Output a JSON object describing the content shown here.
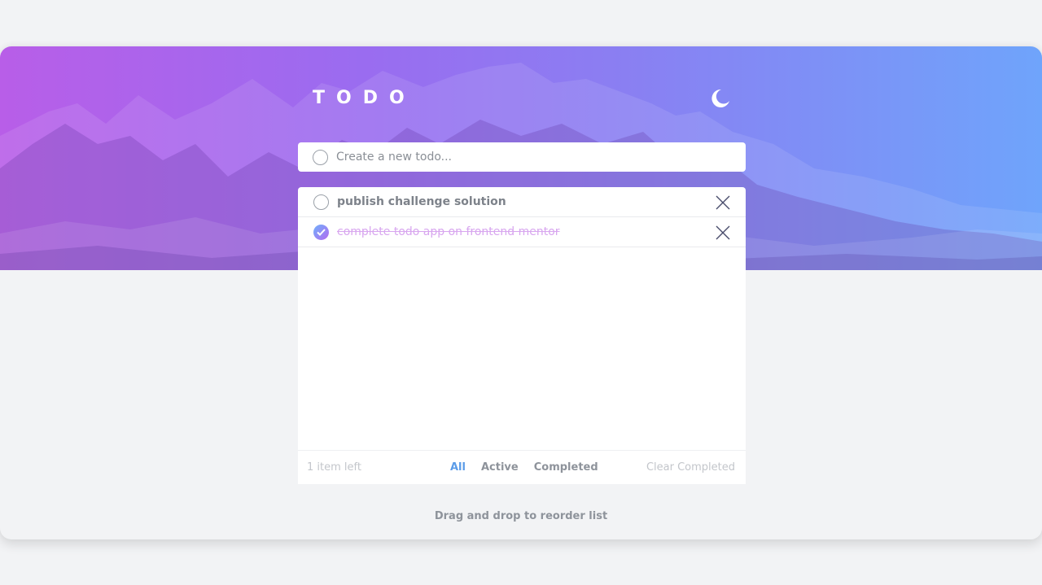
{
  "app": {
    "title": "TODO",
    "theme_icon": "moon-icon"
  },
  "new_todo": {
    "placeholder": "Create a new todo..."
  },
  "todos": [
    {
      "text": "publish challenge solution",
      "completed": false
    },
    {
      "text": "complete todo app on frontend mentor",
      "completed": true
    }
  ],
  "footer": {
    "items_left": "1 item left",
    "filters": {
      "all": "All",
      "active": "Active",
      "completed": "Completed"
    },
    "active_filter": "All",
    "clear_label": "Clear Completed"
  },
  "hint": "Drag and drop to reorder list",
  "colors": {
    "accent": "#5b9ce8",
    "gradient_start": "#b85ee8",
    "gradient_end": "#6fa4fb",
    "completed_text": "#d8a6ef"
  }
}
